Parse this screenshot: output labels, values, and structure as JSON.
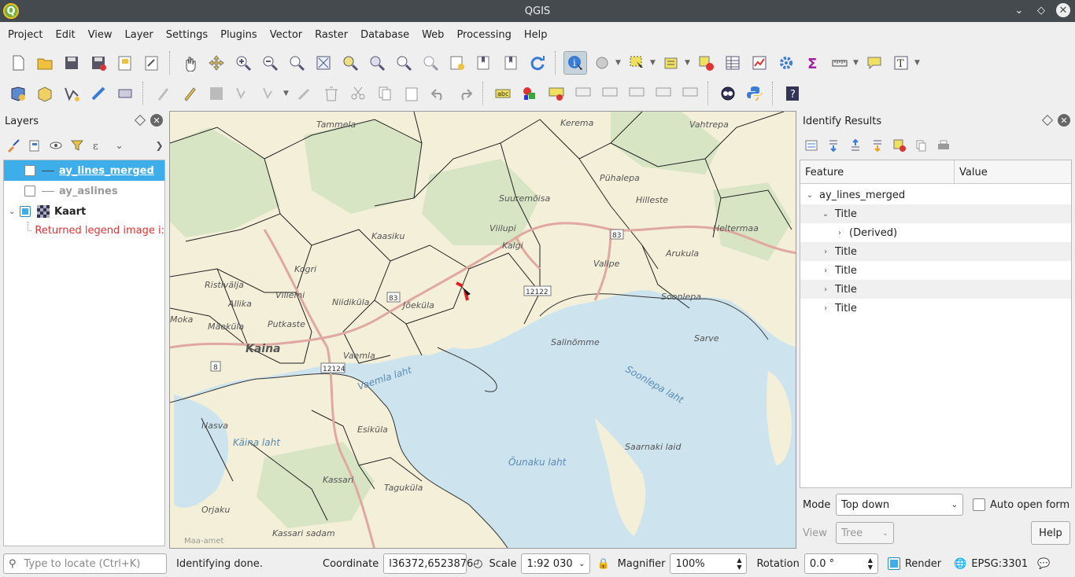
{
  "window": {
    "title": "QGIS",
    "logo": "Q"
  },
  "menu": [
    "Project",
    "Edit",
    "View",
    "Layer",
    "Settings",
    "Plugins",
    "Vector",
    "Raster",
    "Database",
    "Web",
    "Processing",
    "Help"
  ],
  "layers_panel": {
    "title": "Layers",
    "layers": [
      {
        "name": "ay_lines_merged",
        "checked": false,
        "selected": true
      },
      {
        "name": "ay_aslines",
        "checked": false,
        "selected": false
      },
      {
        "name": "Kaart",
        "checked": true,
        "selected": false
      }
    ],
    "error_text": "Returned legend image i:"
  },
  "map": {
    "attribution": "Maa-amet",
    "places": [
      "Tammela",
      "Kerema",
      "Vahtrepa",
      "Pühalepa",
      "Suuremõisa",
      "Hilleste",
      "Heltermaa",
      "Viilupi",
      "Kalgi",
      "Arukula",
      "Kaasiku",
      "Valipe",
      "Kogri",
      "Ristivälja",
      "Villemi",
      "Niidiküla",
      "Jõeküla",
      "Soonlepa",
      "Allika",
      "Mäeküla",
      "Putkaste",
      "Salinõmme",
      "Sarve",
      "Kaina",
      "Vaemla",
      "Vaemla laht",
      "Soonlepa laht",
      "Käina laht",
      "Esiküla",
      "Õunaku laht",
      "Saarnaki laid",
      "Kassari",
      "Taguküla",
      "Orjaku",
      "Kassari sadam",
      "Moka",
      "Nasva"
    ],
    "road_labels": [
      "83",
      "12122",
      "83",
      "8",
      "12124"
    ]
  },
  "identify": {
    "title": "Identify Results",
    "columns": [
      "Feature",
      "Value"
    ],
    "root": "ay_lines_merged",
    "rows": [
      "Title",
      "(Derived)",
      "Title",
      "Title",
      "Title",
      "Title"
    ],
    "mode_label": "Mode",
    "mode_value": "Top down",
    "auto_open_label": "Auto open form",
    "view_label": "View",
    "view_value": "Tree",
    "help_label": "Help"
  },
  "status": {
    "locator_placeholder": "Type to locate (Ctrl+K)",
    "message": "Identifying done.",
    "coordinate_label": "Coordinate",
    "coordinate_value": "l36372,6523876",
    "scale_label": "Scale",
    "scale_value": "1:92 030",
    "magnifier_label": "Magnifier",
    "magnifier_value": "100%",
    "rotation_label": "Rotation",
    "rotation_value": "0.0 °",
    "render_label": "Render",
    "crs": "EPSG:3301"
  }
}
